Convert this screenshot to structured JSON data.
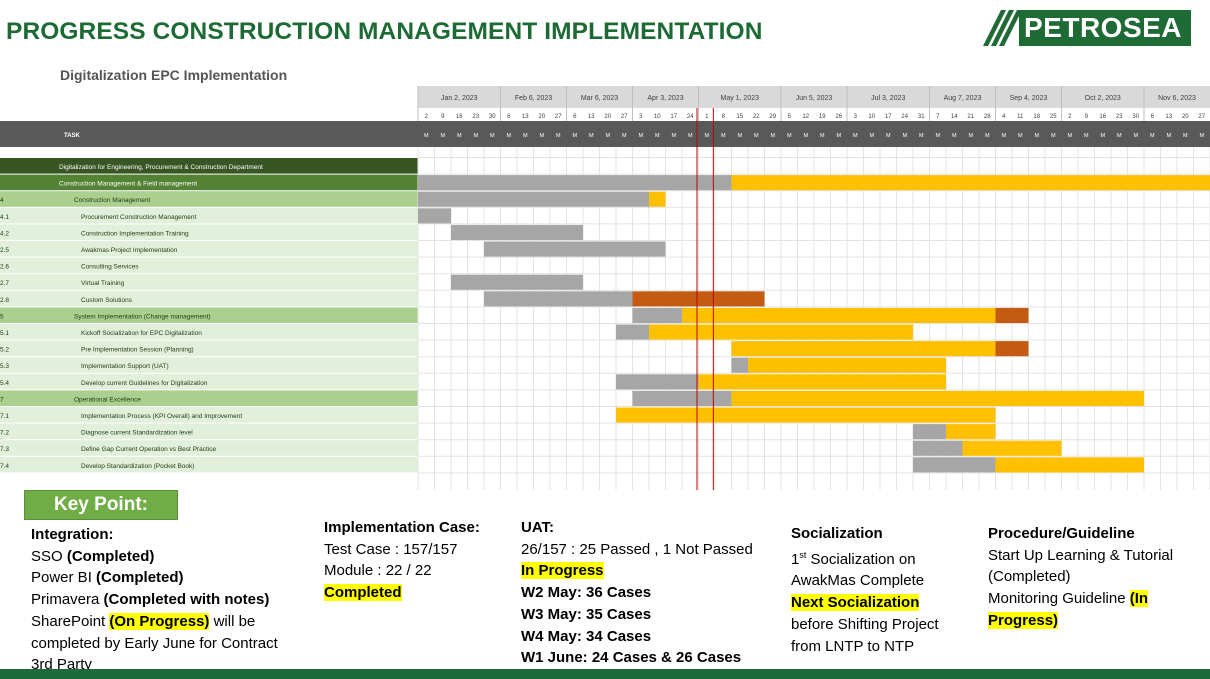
{
  "slide_title": "PROGRESS CONSTRUCTION MANAGEMENT IMPLEMENTATION",
  "logo": "PETROSEA",
  "subtitle": "Digitalization EPC Implementation",
  "colors": {
    "title_green": "#1d6b34",
    "dark_header": "#595959",
    "grey_bar": "#a6a6a6",
    "yellow_bar": "#ffc000",
    "orange_bar": "#c55a11",
    "dark_green_row": "#375623",
    "mid_green_row": "#548235",
    "light_green_row": "#a9d08e",
    "pale_green_row": "#e2efda",
    "today_line": "#c00000"
  },
  "gantt": {
    "task_header": "TASK",
    "week_header_letter": "M",
    "months": [
      {
        "label": "Jan 2, 2023",
        "weeks": [
          "2",
          "9",
          "16",
          "23",
          "30"
        ]
      },
      {
        "label": "Feb 6, 2023",
        "weeks": [
          "6",
          "13",
          "20",
          "27"
        ]
      },
      {
        "label": "Mar 6, 2023",
        "weeks": [
          "6",
          "13",
          "20",
          "27"
        ]
      },
      {
        "label": "Apr 3, 2023",
        "weeks": [
          "3",
          "10",
          "17",
          "24"
        ]
      },
      {
        "label": "May 1, 2023",
        "weeks": [
          "1",
          "8",
          "15",
          "22",
          "29"
        ]
      },
      {
        "label": "Jun 5, 2023",
        "weeks": [
          "5",
          "12",
          "19",
          "26"
        ]
      },
      {
        "label": "Jul 3, 2023",
        "weeks": [
          "3",
          "10",
          "17",
          "24",
          "31"
        ]
      },
      {
        "label": "Aug 7, 2023",
        "weeks": [
          "7",
          "14",
          "21",
          "28"
        ]
      },
      {
        "label": "Sep 4, 2023",
        "weeks": [
          "4",
          "11",
          "18",
          "25"
        ]
      },
      {
        "label": "Oct 2, 2023",
        "weeks": [
          "2",
          "9",
          "16",
          "23",
          "30"
        ]
      },
      {
        "label": "Nov 6, 2023",
        "weeks": [
          "6",
          "13",
          "20",
          "27"
        ]
      }
    ],
    "today_week_index": 17,
    "rows": [
      {
        "id": "",
        "task": "Digitalization for Engineering, Procurement & Construction Department",
        "level": "dark",
        "bars": []
      },
      {
        "id": "",
        "task": "Construction Management & Field management",
        "level": "mid",
        "bars": [
          {
            "s": 0,
            "e": 19,
            "c": "grey"
          },
          {
            "s": 19,
            "e": 48,
            "c": "yellow"
          }
        ]
      },
      {
        "id": "4",
        "task": "Construction Management",
        "level": "light",
        "bars": [
          {
            "s": 0,
            "e": 14,
            "c": "grey"
          },
          {
            "s": 14,
            "e": 15,
            "c": "yellow"
          }
        ]
      },
      {
        "id": "4.1",
        "task": "Procurement Construction Management",
        "level": "pale",
        "bars": [
          {
            "s": 0,
            "e": 2,
            "c": "grey"
          }
        ]
      },
      {
        "id": "4.2",
        "task": "Construction Implementation Training",
        "level": "pale",
        "bars": [
          {
            "s": 2,
            "e": 10,
            "c": "grey"
          }
        ]
      },
      {
        "id": "2.5",
        "task": "Awakmas Project Implementation",
        "level": "pale",
        "bars": [
          {
            "s": 4,
            "e": 15,
            "c": "grey"
          }
        ]
      },
      {
        "id": "2.6",
        "task": "Consulting Services",
        "level": "pale",
        "bars": []
      },
      {
        "id": "2.7",
        "task": "Virtual Training",
        "level": "pale",
        "bars": [
          {
            "s": 2,
            "e": 10,
            "c": "grey"
          }
        ]
      },
      {
        "id": "2.8",
        "task": "Custom Solutions",
        "level": "pale",
        "bars": [
          {
            "s": 4,
            "e": 13,
            "c": "grey"
          },
          {
            "s": 13,
            "e": 21,
            "c": "orange"
          }
        ]
      },
      {
        "id": "5",
        "task": "System Implementation (Change management)",
        "level": "light",
        "bars": [
          {
            "s": 13,
            "e": 16,
            "c": "grey"
          },
          {
            "s": 16,
            "e": 35,
            "c": "yellow"
          },
          {
            "s": 35,
            "e": 37,
            "c": "orange"
          }
        ]
      },
      {
        "id": "5.1",
        "task": "Kickoff Socialization for EPC Digitalization",
        "level": "pale",
        "bars": [
          {
            "s": 12,
            "e": 14,
            "c": "grey"
          },
          {
            "s": 14,
            "e": 30,
            "c": "yellow"
          }
        ]
      },
      {
        "id": "5.2",
        "task": "Pre Implementation Session (Planning)",
        "level": "pale",
        "bars": [
          {
            "s": 19,
            "e": 35,
            "c": "yellow"
          },
          {
            "s": 35,
            "e": 37,
            "c": "orange"
          }
        ]
      },
      {
        "id": "5.3",
        "task": "Implementation Support (UAT)",
        "level": "pale",
        "bars": [
          {
            "s": 19,
            "e": 20,
            "c": "grey"
          },
          {
            "s": 20,
            "e": 32,
            "c": "yellow"
          }
        ]
      },
      {
        "id": "5.4",
        "task": "Develop current Guidelines for Digitalization",
        "level": "pale",
        "bars": [
          {
            "s": 12,
            "e": 17,
            "c": "grey"
          },
          {
            "s": 17,
            "e": 32,
            "c": "yellow"
          }
        ]
      },
      {
        "id": "7",
        "task": "Operational Excellence",
        "level": "light",
        "bars": [
          {
            "s": 13,
            "e": 19,
            "c": "grey"
          },
          {
            "s": 19,
            "e": 44,
            "c": "yellow"
          }
        ]
      },
      {
        "id": "7.1",
        "task": "Implementation Process (KPI Overall) and Improvement",
        "level": "pale",
        "bars": [
          {
            "s": 12,
            "e": 35,
            "c": "yellow"
          }
        ]
      },
      {
        "id": "7.2",
        "task": "Diagnose current Standardization level",
        "level": "pale",
        "bars": [
          {
            "s": 30,
            "e": 32,
            "c": "grey"
          },
          {
            "s": 32,
            "e": 35,
            "c": "yellow"
          }
        ]
      },
      {
        "id": "7.3",
        "task": "Define Gap Current Operation vs Best Practice",
        "level": "pale",
        "bars": [
          {
            "s": 30,
            "e": 33,
            "c": "grey"
          },
          {
            "s": 33,
            "e": 39,
            "c": "yellow"
          }
        ]
      },
      {
        "id": "7.4",
        "task": "Develop Standardization (Pocket Book)",
        "level": "pale",
        "bars": [
          {
            "s": 30,
            "e": 35,
            "c": "grey"
          },
          {
            "s": 35,
            "e": 44,
            "c": "yellow"
          }
        ]
      }
    ]
  },
  "key_point": "Key Point:",
  "notes": {
    "integration": {
      "title": "Integration:",
      "sso": "SSO",
      "sso_status": "(Completed)",
      "powerbi": "Power BI",
      "powerbi_status": "(Completed)",
      "primavera": "Primavera",
      "primavera_status": "(Completed with notes)",
      "sharepoint": "SharePoint",
      "sharepoint_status": "(On Progress)",
      "sharepoint_rest": "will be",
      "line2": "completed by Early June for Contract",
      "line3": "3rd Party"
    },
    "implementation": {
      "title": "Implementation Case:",
      "test_case": "Test Case : 157/157",
      "module": "Module : 22 / 22",
      "status": "Completed"
    },
    "uat": {
      "title": "UAT:",
      "summary": "26/157 : 25 Passed , 1 Not Passed",
      "status": "In Progress",
      "w2": "W2 May: 36 Cases",
      "w3": "W3 May: 35 Cases",
      "w4": "W4 May: 34 Cases",
      "w1": "W1 June: 24 Cases & 26 Cases"
    },
    "socialization": {
      "title": "Socialization",
      "first_sup": "st",
      "line1": "Socialization on",
      "first_num": "1",
      "line2": "AwakMas Complete",
      "next": "Next Socialization",
      "line3": "before Shifting Project",
      "line4": "from LNTP to NTP"
    },
    "procedure": {
      "title": "Procedure/Guideline",
      "line1": "Start Up Learning & Tutorial",
      "line2": "(Completed)",
      "line3": "Monitoring Guideline",
      "status_a": "(In",
      "status_b": "Progress)"
    }
  }
}
